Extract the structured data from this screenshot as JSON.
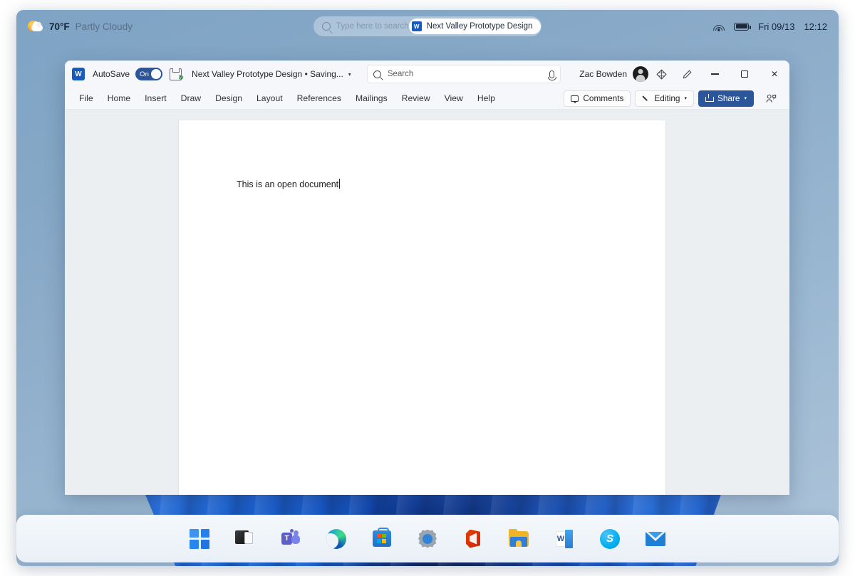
{
  "system_bar": {
    "weather": {
      "icon": "partly-cloudy-icon",
      "temperature": "70°F",
      "condition": "Partly Cloudy"
    },
    "search": {
      "icon": "search-icon",
      "placeholder": "Type here to search"
    },
    "suggestion_chip": {
      "icon": "word-icon",
      "label": "Next Valley Prototype Design"
    },
    "tray": {
      "wifi_icon": "wifi-icon",
      "battery_icon": "battery-icon",
      "date": "Fri 09/13",
      "time": "12:12"
    }
  },
  "word": {
    "title_bar": {
      "app_icon": "word-icon",
      "autosave_label": "AutoSave",
      "autosave_state": "On",
      "save_icon": "save-icon",
      "document_title": "Next Valley Prototype Design • Saving...",
      "title_chevron": "▾",
      "search": {
        "icon": "search-icon",
        "placeholder": "Search",
        "mic_icon": "microphone-icon"
      },
      "user_name": "Zac Bowden",
      "avatar": "user-avatar",
      "copilot_icon": "diamond-icon",
      "ink_icon": "pen-icon",
      "minimize": "—",
      "maximize": "▢",
      "close": "✕"
    },
    "ribbon": {
      "tabs": [
        {
          "label": "File"
        },
        {
          "label": "Home"
        },
        {
          "label": "Insert"
        },
        {
          "label": "Draw"
        },
        {
          "label": "Design"
        },
        {
          "label": "Layout"
        },
        {
          "label": "References"
        },
        {
          "label": "Mailings"
        },
        {
          "label": "Review"
        },
        {
          "label": "View"
        },
        {
          "label": "Help"
        }
      ],
      "comments_label": "Comments",
      "editing_label": "Editing",
      "editing_chevron": "▾",
      "share_label": "Share",
      "share_chevron": "▾",
      "share_people_icon": "share-people-icon",
      "accent_color": "#2b579a"
    },
    "document": {
      "body_text": "This is an open document",
      "caret": "text-caret"
    }
  },
  "taskbar": {
    "items": [
      {
        "name": "start",
        "label": "Start"
      },
      {
        "name": "task-view",
        "label": "Task View"
      },
      {
        "name": "teams",
        "label": "Microsoft Teams",
        "glyph": "T"
      },
      {
        "name": "edge",
        "label": "Microsoft Edge"
      },
      {
        "name": "store",
        "label": "Microsoft Store"
      },
      {
        "name": "settings",
        "label": "Settings"
      },
      {
        "name": "office",
        "label": "Office"
      },
      {
        "name": "file-explorer",
        "label": "File Explorer"
      },
      {
        "name": "word",
        "label": "Word",
        "glyph": "W"
      },
      {
        "name": "skype",
        "label": "Skype",
        "glyph": "S"
      },
      {
        "name": "mail",
        "label": "Mail"
      }
    ]
  }
}
